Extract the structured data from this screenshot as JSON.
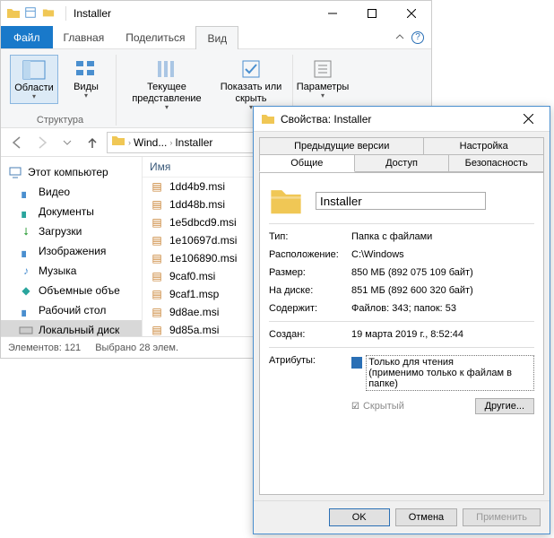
{
  "explorer": {
    "title": "Installer",
    "menu": {
      "file": "Файл",
      "home": "Главная",
      "share": "Поделиться",
      "view": "Вид"
    },
    "ribbon": {
      "areas": "Области",
      "views": "Виды",
      "current": "Текущее представление",
      "showhide": "Показать или скрыть",
      "params": "Параметры",
      "group_struct": "Структура"
    },
    "breadcrumbs": {
      "a": "Wind...",
      "b": "Installer"
    },
    "column_name": "Имя",
    "tree": {
      "this_pc": "Этот компьютер",
      "videos": "Видео",
      "documents": "Документы",
      "downloads": "Загрузки",
      "pictures": "Изображения",
      "music": "Музыка",
      "objects3d": "Объемные объе",
      "desktop": "Рабочий стол",
      "localdisk": "Локальный диск"
    },
    "files": [
      "1dd4b9.msi",
      "1dd48b.msi",
      "1e5dbcd9.msi",
      "1e10697d.msi",
      "1e106890.msi",
      "9caf0.msi",
      "9caf1.msp",
      "9d8ae.msi",
      "9d85a.msi"
    ],
    "status": {
      "elements": "Элементов: 121",
      "selected": "Выбрано 28 элем."
    }
  },
  "props": {
    "title": "Свойства: Installer",
    "tabs": {
      "prev": "Предыдущие версии",
      "customize": "Настройка",
      "general": "Общие",
      "sharing": "Доступ",
      "security": "Безопасность"
    },
    "name_value": "Installer",
    "rows": {
      "type_l": "Тип:",
      "type_v": "Папка с файлами",
      "loc_l": "Расположение:",
      "loc_v": "C:\\Windows",
      "size_l": "Размер:",
      "size_v": "850 МБ (892 075 109 байт)",
      "ondisk_l": "На диске:",
      "ondisk_v": "851 МБ (892 600 320 байт)",
      "contains_l": "Содержит:",
      "contains_v": "Файлов: 343; папок: 53",
      "created_l": "Создан:",
      "created_v": "19 марта 2019 г., 8:52:44",
      "attrs_l": "Атрибуты:",
      "readonly1": "Только для чтения",
      "readonly2": "(применимо только к файлам в папке)",
      "hidden": "Скрытый",
      "other": "Другие..."
    },
    "buttons": {
      "ok": "OK",
      "cancel": "Отмена",
      "apply": "Применить"
    }
  }
}
